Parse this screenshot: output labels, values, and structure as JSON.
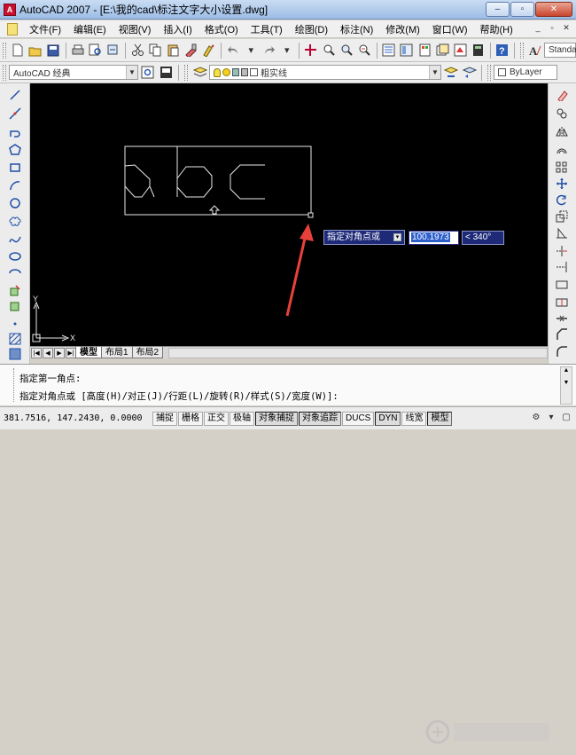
{
  "window": {
    "title": "AutoCAD 2007 - [E:\\我的cad\\标注文字大小设置.dwg]",
    "minimize": "–",
    "restore": "▫",
    "close": "✕",
    "app_icon_letter": "A"
  },
  "menubar": {
    "items": [
      "文件(F)",
      "编辑(E)",
      "视图(V)",
      "插入(I)",
      "格式(O)",
      "工具(T)",
      "绘图(D)",
      "标注(N)",
      "修改(M)",
      "窗口(W)",
      "帮助(H)"
    ]
  },
  "toolbar1": {
    "style_combo": "Standa"
  },
  "toolbar2": {
    "workspace": "AutoCAD 经典",
    "layer": "粗实线",
    "color": "ByLayer"
  },
  "layout_tabs": [
    "模型",
    "布局1",
    "布局2"
  ],
  "ucs": {
    "x": "X",
    "y": "Y"
  },
  "dynamic_input": {
    "prompt": "指定对角点或",
    "value": "100.1973",
    "angle": "< 340°"
  },
  "command": {
    "line1": "指定第一角点:",
    "line2": "指定对角点或 [高度(H)/对正(J)/行距(L)/旋转(R)/样式(S)/宽度(W)]:"
  },
  "status": {
    "coords": "381.7516, 147.2430, 0.0000",
    "buttons": [
      "捕捉",
      "栅格",
      "正交",
      "极轴",
      "对象捕捉",
      "对象追踪",
      "DUCS",
      "DYN",
      "线宽",
      "模型"
    ]
  },
  "colors": {
    "canvas": "#000000",
    "lines": "#e8e8e8",
    "arrow": "#e8413a",
    "dyn_bg": "#1e2a78"
  }
}
